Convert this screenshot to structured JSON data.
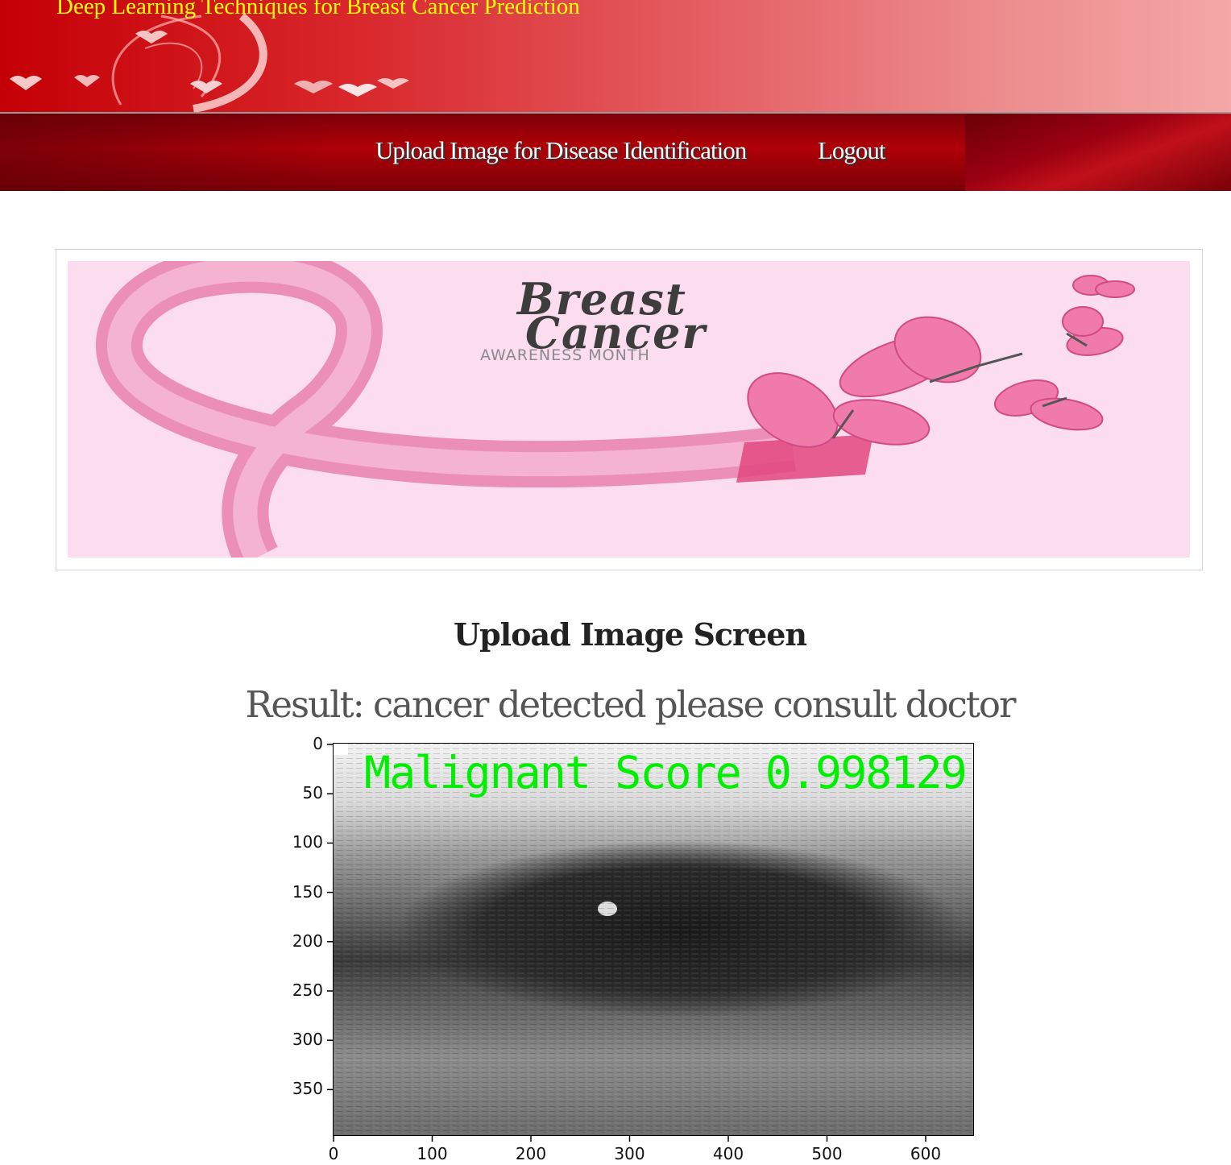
{
  "header": {
    "site_title": "Deep Learning Techniques for Breast Cancer Prediction"
  },
  "nav": {
    "items": [
      {
        "label": "Upload Image for Disease Identification"
      },
      {
        "label": "Logout"
      }
    ]
  },
  "banner": {
    "title_line1": "Breast",
    "title_line2": "Cancer",
    "subtitle": "AWARENESS MONTH"
  },
  "main": {
    "heading": "Upload Image Screen",
    "result": "Result: cancer detected please consult doctor"
  },
  "result_figure": {
    "overlay_text": "Malignant Score 0.998129",
    "overlay_color": "#00ee00",
    "y_ticks": [
      "0",
      "50",
      "100",
      "150",
      "200",
      "250",
      "300",
      "350"
    ],
    "x_ticks": [
      "0",
      "100",
      "200",
      "300",
      "400",
      "500",
      "600"
    ],
    "x_range": [
      0,
      650
    ],
    "y_range": [
      0,
      400
    ]
  },
  "colors": {
    "header_red": "#c40006",
    "nav_dark_red": "#9a0008",
    "title_yellow": "#ffff00",
    "banner_pink": "#fcdcef"
  }
}
